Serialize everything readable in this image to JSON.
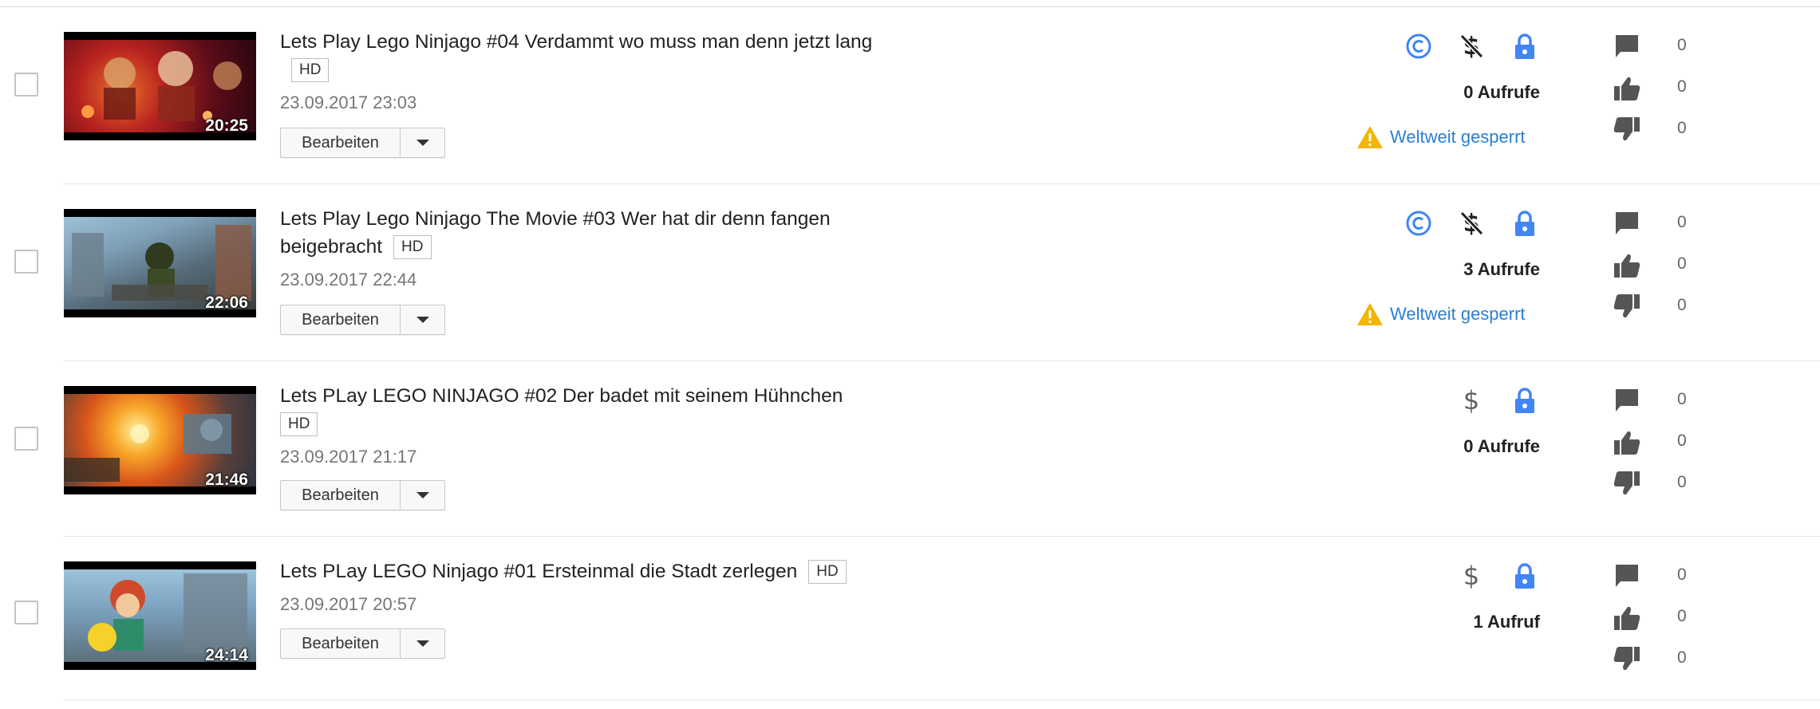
{
  "videos": [
    {
      "title": "Lets Play Lego Ninjago #04 Verdammt wo muss man denn jetzt lang",
      "hd": "HD",
      "date": "23.09.2017 23:03",
      "duration": "20:25",
      "edit_label": "Bearbeiten",
      "views": "0 Aufrufe",
      "status": "Weltweit gesperrt",
      "comments": "0",
      "likes": "0",
      "dislikes": "0",
      "monetization": "not-monetized",
      "has_copyright_claim": true
    },
    {
      "title": "Lets Play Lego Ninjago The Movie #03 Wer hat dir denn fangen beigebracht",
      "hd": "HD",
      "date": "23.09.2017 22:44",
      "duration": "22:06",
      "edit_label": "Bearbeiten",
      "views": "3 Aufrufe",
      "status": "Weltweit gesperrt",
      "comments": "0",
      "likes": "0",
      "dislikes": "0",
      "monetization": "not-monetized",
      "has_copyright_claim": true
    },
    {
      "title": "Lets PLay LEGO NINJAGO #02 Der badet mit seinem Hühnchen",
      "hd": "HD",
      "date": "23.09.2017 21:17",
      "duration": "21:46",
      "edit_label": "Bearbeiten",
      "views": "0 Aufrufe",
      "comments": "0",
      "likes": "0",
      "dislikes": "0",
      "monetization": "monetized",
      "has_copyright_claim": false
    },
    {
      "title": "Lets PLay LEGO Ninjago #01 Ersteinmal die Stadt zerlegen",
      "hd": "HD",
      "date": "23.09.2017 20:57",
      "duration": "24:14",
      "edit_label": "Bearbeiten",
      "views": "1 Aufruf",
      "comments": "0",
      "likes": "0",
      "dislikes": "0",
      "monetization": "monetized",
      "has_copyright_claim": false
    }
  ],
  "icons": {
    "copyright": "copyright-icon",
    "not_monetized": "dollar-crossed-icon",
    "monetized": "dollar-icon",
    "private": "lock-icon",
    "warning": "warning-icon",
    "comments": "comment-icon",
    "likes": "thumbs-up-icon",
    "dislikes": "thumbs-down-icon"
  },
  "colors": {
    "accent_blue": "#4285f4",
    "link_blue": "#2b7fd4",
    "warning_yellow": "#f4b400",
    "icon_dark": "#222222",
    "icon_gray": "#606060"
  }
}
